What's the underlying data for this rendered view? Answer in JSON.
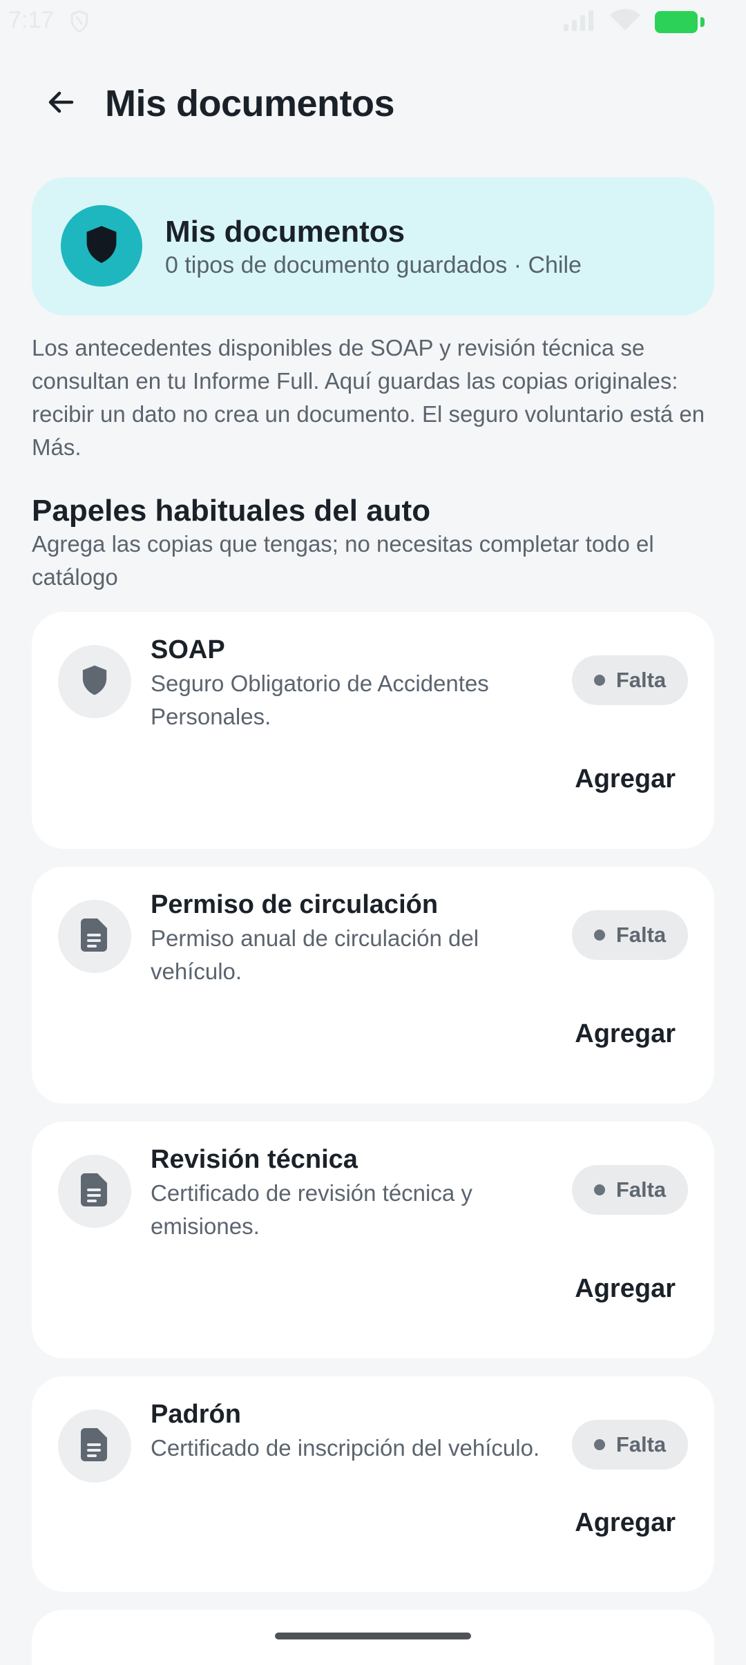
{
  "status_bar": {
    "time": "7:17",
    "icons": [
      "shield-outline-icon",
      "signal-icon",
      "wifi-icon",
      "battery-icon"
    ],
    "battery_color": "#2bd257"
  },
  "app_bar": {
    "title": "Mis documentos",
    "back_icon": "arrow-back-icon"
  },
  "summary": {
    "title": "Mis documentos",
    "subtitle": "0 tipos de documento guardados · Chile",
    "icon": "shield-icon",
    "accent_color": "#1eb7c0",
    "background_color": "#d8f6f8"
  },
  "intro": "Los antecedentes disponibles de SOAP y revisión técnica se consultan en tu Informe Full. Aquí guardas las copias originales: recibir un dato no crea un documento. El seguro voluntario está en Más.",
  "section": {
    "title": "Papeles habituales del auto",
    "subtitle": "Agrega las copias que tengas; no necesitas completar todo el catálogo"
  },
  "documents": [
    {
      "icon": "shield-icon",
      "title": "SOAP",
      "description": "Seguro Obligatorio de Accidentes Personales.",
      "status": "Falta",
      "action": "Agregar"
    },
    {
      "icon": "document-icon",
      "title": "Permiso de circulación",
      "description": "Permiso anual de circulación del vehículo.",
      "status": "Falta",
      "action": "Agregar"
    },
    {
      "icon": "document-icon",
      "title": "Revisión técnica",
      "description": "Certificado de revisión técnica y emisiones.",
      "status": "Falta",
      "action": "Agregar"
    },
    {
      "icon": "document-icon",
      "title": "Padrón",
      "description": "Certificado de inscripción del vehículo.",
      "status": "Falta",
      "action": "Agregar"
    }
  ]
}
